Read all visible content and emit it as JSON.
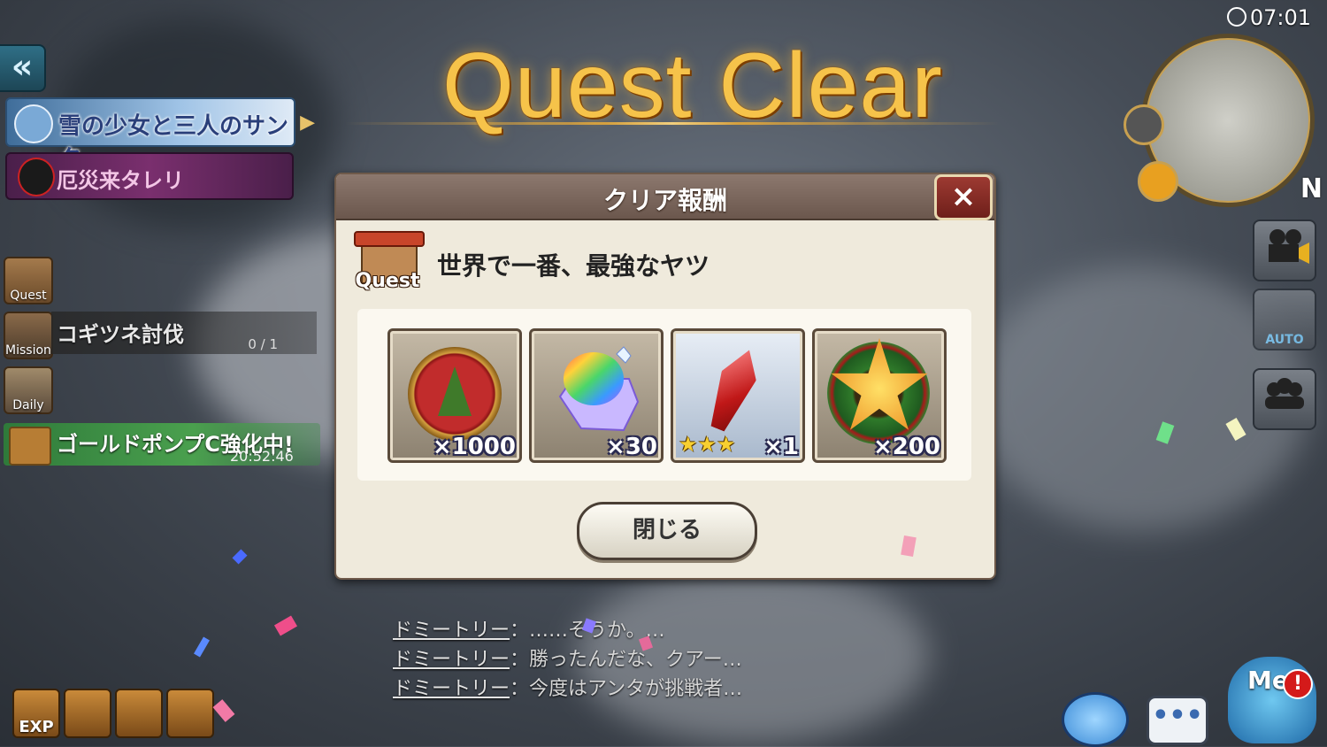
{
  "header": {
    "title": "Quest Clear",
    "time": "07:01"
  },
  "left_panel": {
    "event_banner": "雪の少女と三人のサンタ",
    "boss_banner": "厄災来タレリ",
    "icons": [
      {
        "label": "Quest"
      },
      {
        "label": "Mission"
      },
      {
        "label": "Daily"
      }
    ],
    "mission_title": "コギツネ討伐",
    "mission_progress": "0 / 1",
    "gold_title": "ゴールドポンプC強化中!",
    "gold_timer": "20:52:46"
  },
  "dialog": {
    "title": "クリア報酬",
    "close_x": "×",
    "quest_icon_label": "Quest",
    "quest_name": "世界で一番、最強なヤツ",
    "rewards": [
      {
        "icon": "christmas-tree-medal-icon",
        "count": "×1000"
      },
      {
        "icon": "rainbow-gem-icon",
        "count": "×30"
      },
      {
        "icon": "red-crystal-icon",
        "count": "×1",
        "stars": "★★★"
      },
      {
        "icon": "christmas-star-wreath-icon",
        "count": "×200"
      }
    ],
    "close_button": "閉じる"
  },
  "chat": [
    {
      "speaker": "ドミートリー",
      "text": "：……そうか。…"
    },
    {
      "speaker": "ドミートリー",
      "text": "：勝ったんだな、クアー…"
    },
    {
      "speaker": "ドミートリー",
      "text": "：今度はアンタが挑戦者…"
    }
  ],
  "bottom_left": {
    "exp_label": "EXP"
  },
  "right_panel": {
    "minimap_north": "N",
    "auto_label": "AUTO",
    "me_label": "Me",
    "alert": "!",
    "chat_button": "•••"
  },
  "colors": {
    "title_gold": "#f6c34a",
    "dialog_bg": "#efeadc",
    "dialog_header": "#7a655b",
    "close_red": "#8a2a24"
  }
}
